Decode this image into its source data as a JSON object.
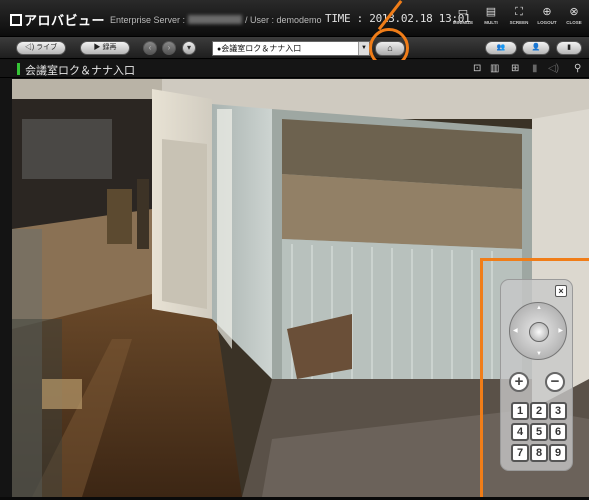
{
  "titlebar": {
    "logo": "アロバビュー",
    "server_label": "Enterprise Server :",
    "user_text": "/ User : demodemo",
    "time_text": "TIME : 2013.02.18 13:01",
    "controls": [
      {
        "icon": "minimize-icon",
        "label": "MINIMIZE"
      },
      {
        "icon": "multi-icon",
        "label": "MULTI"
      },
      {
        "icon": "screen-icon",
        "label": "SCREEN"
      },
      {
        "icon": "logout-icon",
        "label": "LOGOUT"
      },
      {
        "icon": "close-icon",
        "label": "CLOSE"
      }
    ]
  },
  "toolbar": {
    "live_label": "ライブ",
    "record_label": "録再",
    "camera_selected": "会議室ロク＆ナナ入口"
  },
  "camera": {
    "title": "会議室ロク＆ナナ入口"
  },
  "ptz": {
    "zoom_in": "+",
    "zoom_out": "−",
    "close": "×",
    "presets": [
      "1",
      "2",
      "3",
      "4",
      "5",
      "6",
      "7",
      "8",
      "9"
    ]
  },
  "colors": {
    "accent": "#f07d18",
    "status": "#35c436"
  }
}
